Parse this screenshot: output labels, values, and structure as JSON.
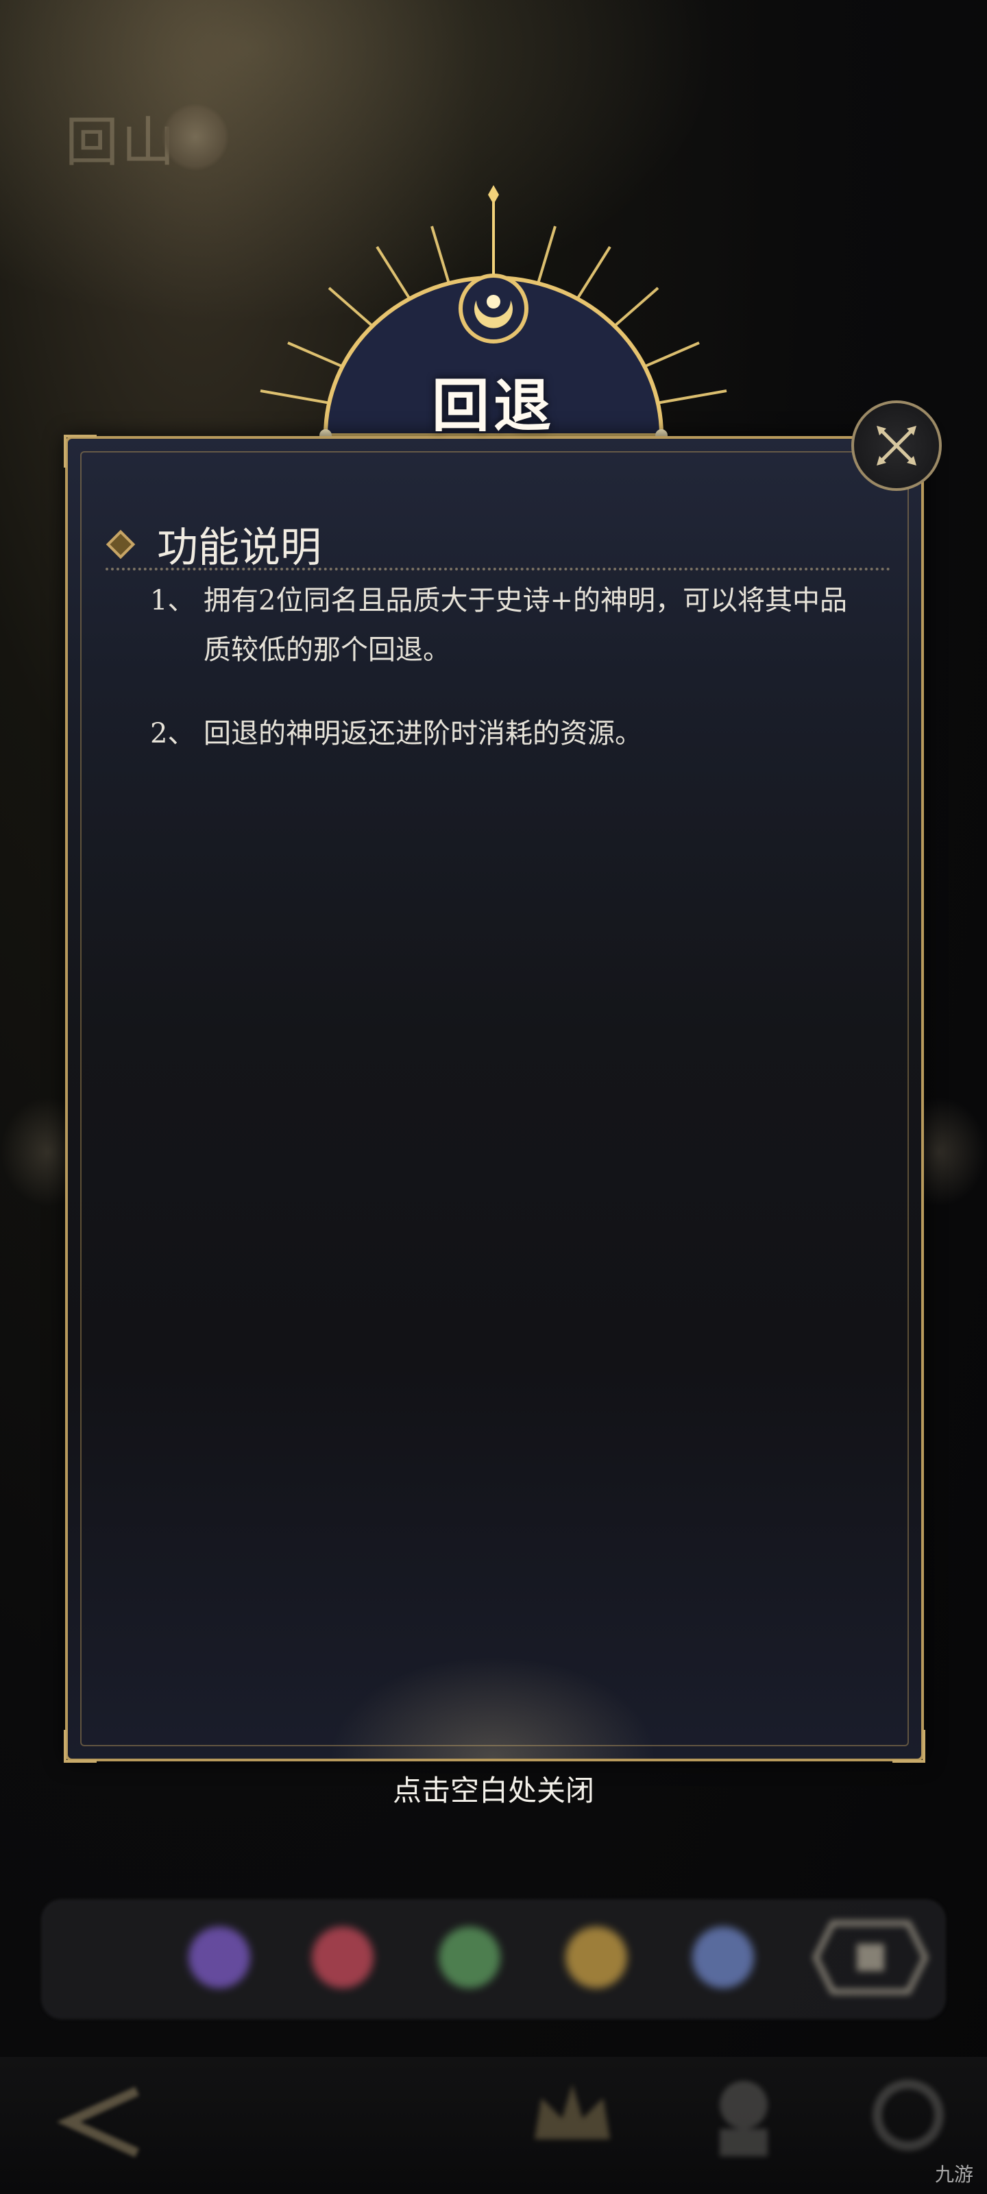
{
  "dialog": {
    "title": "回退",
    "section_title": "功能说明",
    "items": [
      {
        "num": "1、",
        "text": "拥有2位同名且品质大于史诗+的神明，可以将其中品质较低的那个回退。"
      },
      {
        "num": "2、",
        "text": "回退的神明返还进阶时消耗的资源。"
      }
    ],
    "close_hint": "点击空白处关闭"
  },
  "background": {
    "logo_text": "回山",
    "gem_colors": [
      "#7e5cc9",
      "#c94b5b",
      "#5fa061",
      "#c9a045",
      "#6f86c9"
    ]
  },
  "watermark": "九游"
}
